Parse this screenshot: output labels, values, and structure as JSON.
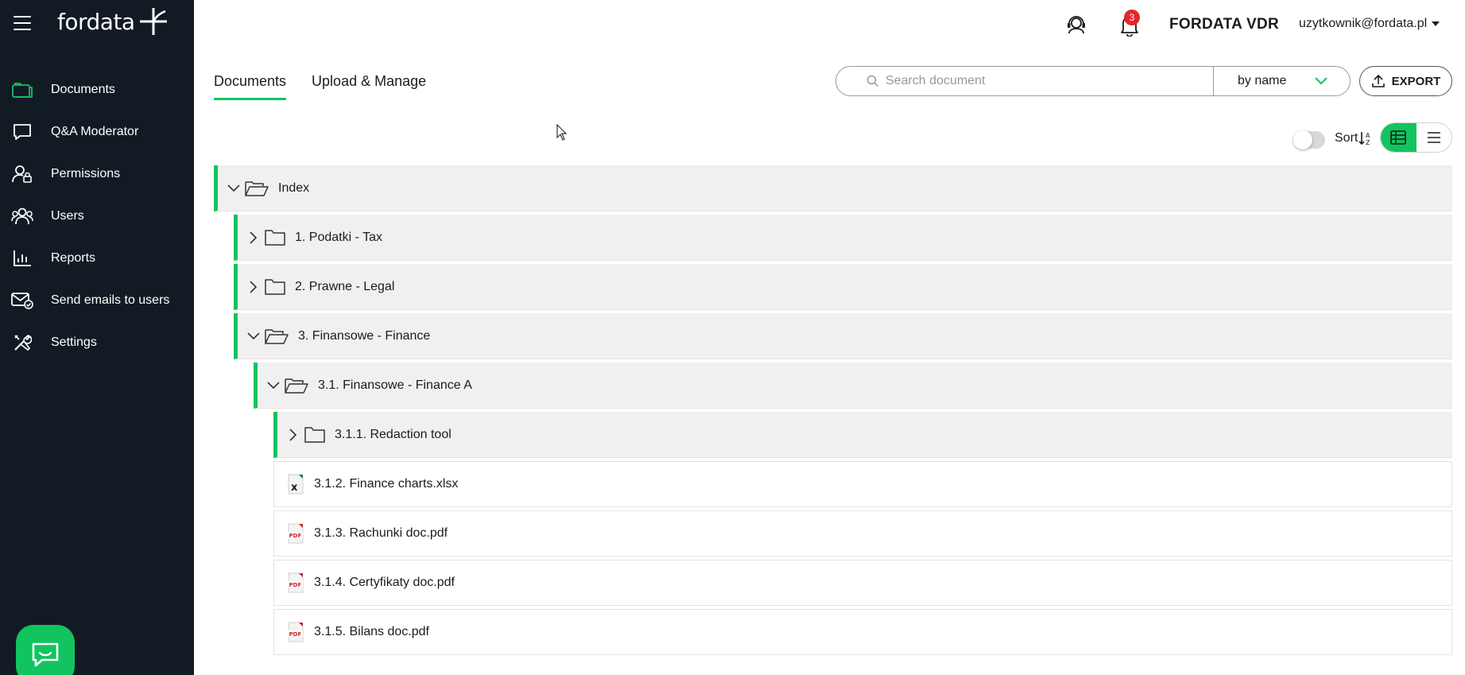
{
  "brand": {
    "logo_text": "fordata"
  },
  "sidebar": {
    "items": [
      {
        "label": "Documents",
        "icon": "folder-icon",
        "active": true
      },
      {
        "label": "Q&A Moderator",
        "icon": "chat-icon"
      },
      {
        "label": "Permissions",
        "icon": "user-lock-icon"
      },
      {
        "label": "Users",
        "icon": "users-icon"
      },
      {
        "label": "Reports",
        "icon": "chart-icon"
      },
      {
        "label": "Send emails to users",
        "icon": "mail-icon"
      },
      {
        "label": "Settings",
        "icon": "tools-icon"
      }
    ]
  },
  "header": {
    "notifications_count": "3",
    "vdr_name": "FORDATA VDR",
    "user_email": "uzytkownik@fordata.pl"
  },
  "tabs": [
    {
      "label": "Documents",
      "active": true
    },
    {
      "label": "Upload & Manage",
      "active": false
    }
  ],
  "search": {
    "placeholder": "Search document",
    "mode": "by name"
  },
  "toolbar": {
    "export_label": "EXPORT",
    "sort_label": "Sort"
  },
  "colors": {
    "accent": "#12c45f",
    "sidebar_bg": "#121b24",
    "badge": "#e5262d"
  },
  "tree": {
    "rows": [
      {
        "label": "Index",
        "type": "folder",
        "expanded": true,
        "level": 0
      },
      {
        "label": "1. Podatki - Tax",
        "type": "folder",
        "expanded": false,
        "level": 1
      },
      {
        "label": "2. Prawne - Legal",
        "type": "folder",
        "expanded": false,
        "level": 1
      },
      {
        "label": "3. Finansowe - Finance",
        "type": "folder",
        "expanded": true,
        "level": 1
      },
      {
        "label": "3.1. Finansowe - Finance A",
        "type": "folder",
        "expanded": true,
        "level": 2
      },
      {
        "label": "3.1.1. Redaction tool",
        "type": "folder",
        "expanded": false,
        "level": 3
      },
      {
        "label": "3.1.2. Finance charts.xlsx",
        "type": "xlsx",
        "level": 3
      },
      {
        "label": "3.1.3. Rachunki doc.pdf",
        "type": "pdf",
        "level": 3
      },
      {
        "label": "3.1.4. Certyfikaty doc.pdf",
        "type": "pdf",
        "level": 3
      },
      {
        "label": "3.1.5. Bilans doc.pdf",
        "type": "pdf",
        "level": 3
      }
    ]
  }
}
